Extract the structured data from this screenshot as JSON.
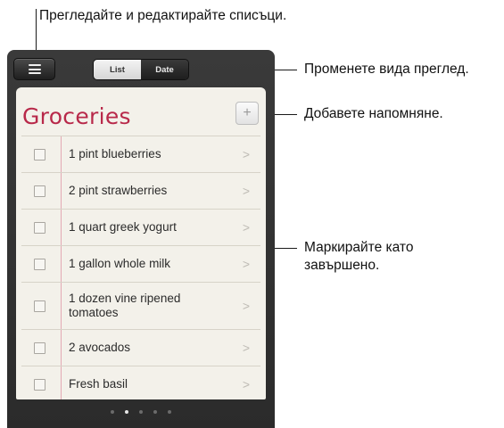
{
  "callouts": {
    "lists": "Прегледайте и редактирайте списъци.",
    "view": "Променете вида преглед.",
    "add": "Добавете напомняне.",
    "mark": "Маркирайте като\nзавършено."
  },
  "toolbar": {
    "list_label": "List",
    "date_label": "Date"
  },
  "list": {
    "title": "Groceries",
    "add_icon": "+",
    "items": [
      {
        "label": "1 pint blueberries"
      },
      {
        "label": "2 pint strawberries"
      },
      {
        "label": "1 quart greek yogurt"
      },
      {
        "label": "1 gallon whole milk"
      },
      {
        "label": "1 dozen vine ripened tomatoes"
      },
      {
        "label": "2 avocados"
      },
      {
        "label": "Fresh basil"
      }
    ]
  },
  "page_indicator": {
    "count": 5,
    "current": 2
  },
  "colors": {
    "title": "#b8294a",
    "frame": "#2e2e2e",
    "paper": "#f3f1ea"
  }
}
